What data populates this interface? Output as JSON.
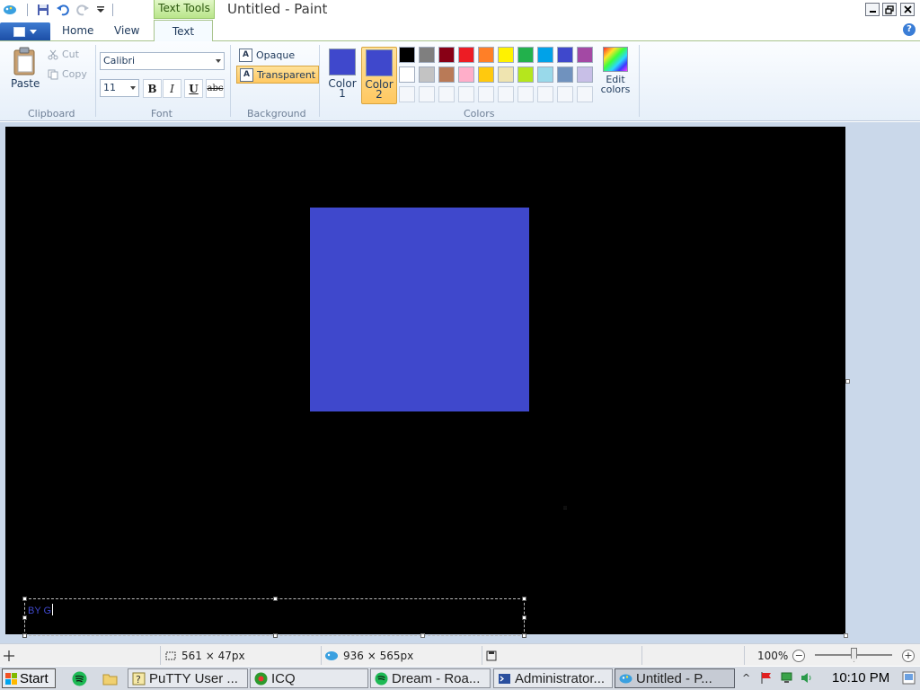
{
  "window": {
    "title": "Untitled - Paint",
    "context_tab": "Text Tools"
  },
  "tabs": [
    {
      "label": "Home"
    },
    {
      "label": "View"
    },
    {
      "label": "Text"
    }
  ],
  "clipboard": {
    "paste_label": "Paste",
    "cut_label": "Cut",
    "copy_label": "Copy",
    "group_label": "Clipboard"
  },
  "font": {
    "family": "Calibri",
    "size": "11",
    "bold_label": "B",
    "italic_label": "I",
    "underline_label": "U",
    "strike_label": "abc",
    "group_label": "Font"
  },
  "background": {
    "opaque_label": "Opaque",
    "transparent_label": "Transparent",
    "selected": "Transparent",
    "group_label": "Background"
  },
  "colors": {
    "color1_label": "Color 1",
    "color2_label": "Color 2",
    "color1_value": "#3f48cc",
    "color2_value": "#3f48cc",
    "edit_label": "Edit colors",
    "group_label": "Colors",
    "palette": [
      "#000000",
      "#7f7f7f",
      "#880015",
      "#ed1c24",
      "#ff7f27",
      "#fff200",
      "#22b14c",
      "#00a2e8",
      "#3f48cc",
      "#a349a4",
      "#ffffff",
      "#c3c3c3",
      "#b97a57",
      "#ffaec9",
      "#ffc90e",
      "#efe4b0",
      "#b5e61d",
      "#99d9ea",
      "#7092be",
      "#c8bfe7",
      "",
      "",
      "",
      "",
      "",
      "",
      "",
      "",
      "",
      ""
    ]
  },
  "canvas": {
    "background": "#000000",
    "shape_color": "#3f48cc",
    "text_content": "BY G"
  },
  "status": {
    "selection_size": "561 × 47px",
    "image_size": "936 × 565px",
    "zoom": "100%"
  },
  "taskbar": {
    "start_label": "Start",
    "tasks": [
      {
        "label": "PuTTY User ..."
      },
      {
        "label": "ICQ"
      },
      {
        "label": "Dream - Roa..."
      },
      {
        "label": "Administrator..."
      },
      {
        "label": "Untitled - P..."
      }
    ],
    "clock": "10:10 PM"
  }
}
